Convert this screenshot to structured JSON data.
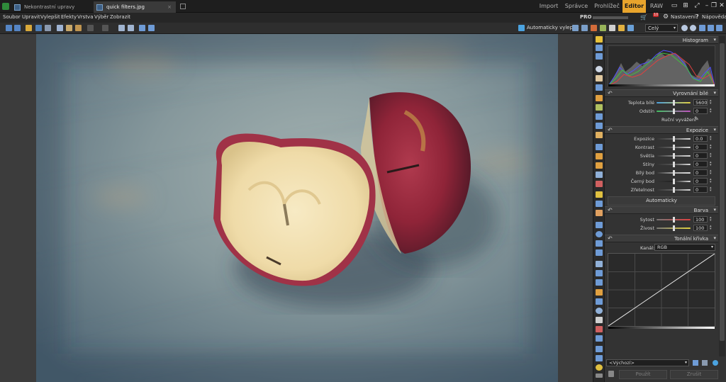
{
  "tabs": {
    "doc1": "Nekontrastní upravy",
    "doc2": "quick filters.jpg",
    "modes": [
      "Import",
      "Správce",
      "Prohlížeč",
      "Editor",
      "RAW"
    ],
    "active_mode": "Editor"
  },
  "menu": [
    "Soubor",
    "Upravit",
    "Vylepšit",
    "Efekty",
    "Vrstva",
    "Výběr",
    "Zobrazit"
  ],
  "topright": {
    "pro": "PRO",
    "settings": "Nastavení",
    "help": "Nápověda",
    "badge": "10"
  },
  "toolbar": {
    "auto_enhance": "Automaticky vylepšit",
    "zoom": "Celý"
  },
  "panel": {
    "histogram": "Histogram",
    "white_balance": {
      "title": "Vyrovnání bílé",
      "rows": [
        {
          "label": "Teplota bílé",
          "value": "5600"
        },
        {
          "label": "Odstín",
          "value": "0"
        }
      ],
      "manual": "Ruční vyvážení"
    },
    "exposure": {
      "title": "Expozice",
      "rows": [
        {
          "label": "Expozice",
          "value": "0.0"
        },
        {
          "label": "Kontrast",
          "value": "0"
        },
        {
          "label": "Světla",
          "value": "0"
        },
        {
          "label": "Stíny",
          "value": "0"
        },
        {
          "label": "Bílý bod",
          "value": "0"
        },
        {
          "label": "Černý bod",
          "value": "0"
        },
        {
          "label": "Zřetelnost",
          "value": "0"
        }
      ],
      "auto_button": "Automaticky"
    },
    "color": {
      "title": "Barva",
      "rows": [
        {
          "label": "Sytost",
          "value": "100"
        },
        {
          "label": "Živost",
          "value": "100"
        }
      ]
    },
    "curve": {
      "title": "Tonální křivka",
      "channel_label": "Kanál:",
      "channel_value": "RGB"
    },
    "preset": "<Výchozí>",
    "apply": "Použít",
    "cancel": "Zrušit"
  },
  "colors": {
    "accent": "#e8a42c",
    "panel_bg": "#333333"
  }
}
